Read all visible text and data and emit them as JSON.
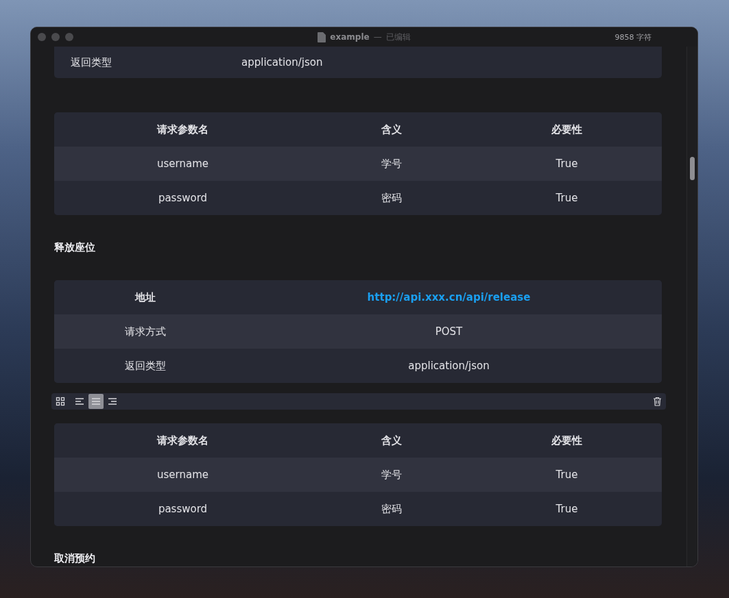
{
  "window": {
    "title": "example",
    "separator": "—",
    "subtitle": "已编辑",
    "char_count": "9858 字符"
  },
  "blocks": [
    {
      "kind": "info",
      "rows": [
        {
          "label": "返回类型",
          "value": "application/json"
        }
      ]
    },
    {
      "kind": "params",
      "columns": [
        "请求参数名",
        "含义",
        "必要性"
      ],
      "rows": [
        [
          "username",
          "学号",
          "True"
        ],
        [
          "password",
          "密码",
          "True"
        ]
      ]
    },
    {
      "kind": "heading",
      "text": "释放座位"
    },
    {
      "kind": "info",
      "header": {
        "label": "地址",
        "link": "http://api.xxx.cn/api/release"
      },
      "rows": [
        {
          "label": "请求方式",
          "value": "POST"
        },
        {
          "label": "返回类型",
          "value": "application/json"
        }
      ]
    },
    {
      "kind": "toolbar",
      "buttons": [
        {
          "kind": "grid",
          "selected": false
        },
        {
          "kind": "align-left",
          "selected": false
        },
        {
          "kind": "align-center",
          "selected": true
        },
        {
          "kind": "align-right",
          "selected": false
        }
      ]
    },
    {
      "kind": "params",
      "columns": [
        "请求参数名",
        "含义",
        "必要性"
      ],
      "rows": [
        [
          "username",
          "学号",
          "True"
        ],
        [
          "password",
          "密码",
          "True"
        ]
      ]
    },
    {
      "kind": "heading",
      "text": "取消预约"
    }
  ]
}
